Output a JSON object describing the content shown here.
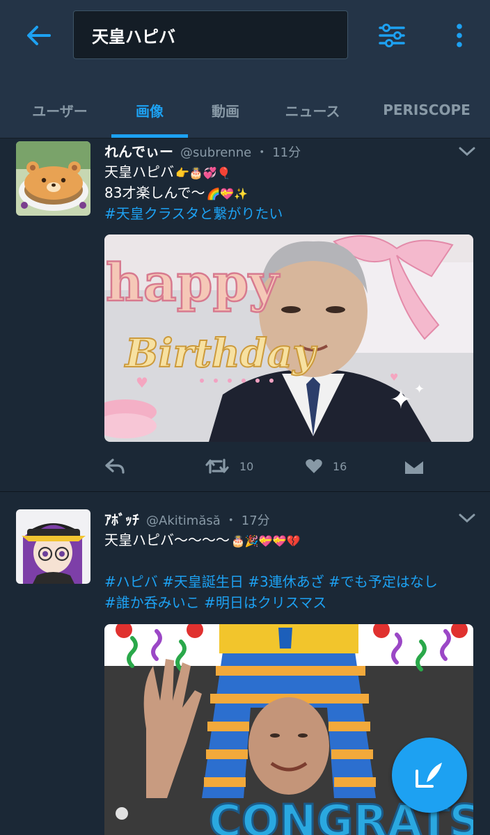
{
  "search": {
    "query": "天皇ハピバ"
  },
  "tabs": [
    {
      "label": "ユーザー"
    },
    {
      "label": "画像"
    },
    {
      "label": "動画"
    },
    {
      "label": "ニュース"
    },
    {
      "label": "PERISCOPE"
    }
  ],
  "active_tab": "画像",
  "tweets": [
    {
      "name": "れんでぃー",
      "handle": "@subrenne",
      "separator": "・",
      "time": "11分",
      "line1": "天皇ハピバ",
      "line1_emoji": "👉🎂💞🎈",
      "line2": "83才楽しんで～",
      "line2_emoji": "🌈💝✨",
      "hashtags": [
        "#天皇クラスタと繋がりたい"
      ],
      "media_text": {
        "line1": "happy",
        "line2": "Birthday"
      },
      "reply_icon": "reply-icon",
      "retweet_count": "10",
      "like_count": "16"
    },
    {
      "name": "ｱﾎﾞｯﾁ",
      "handle": "@Akitimăsă",
      "separator": "・",
      "time": "17分",
      "line1": "天皇ハピバ～～～～",
      "line1_emoji": "🎂🎉💝💝💔",
      "hashtags_line1": [
        "#ハピバ",
        "#天皇誕生日",
        "#3連休あざ",
        "#でも予定はなし"
      ],
      "hashtags_line2": [
        "#誰か呑みいこ",
        "#明日はクリスマス"
      ],
      "media_text": {
        "line1": "CONGRATS"
      }
    }
  ],
  "colors": {
    "background": "#1b2836",
    "header": "#243447",
    "accent": "#1da1f2",
    "muted": "#8899a6"
  }
}
